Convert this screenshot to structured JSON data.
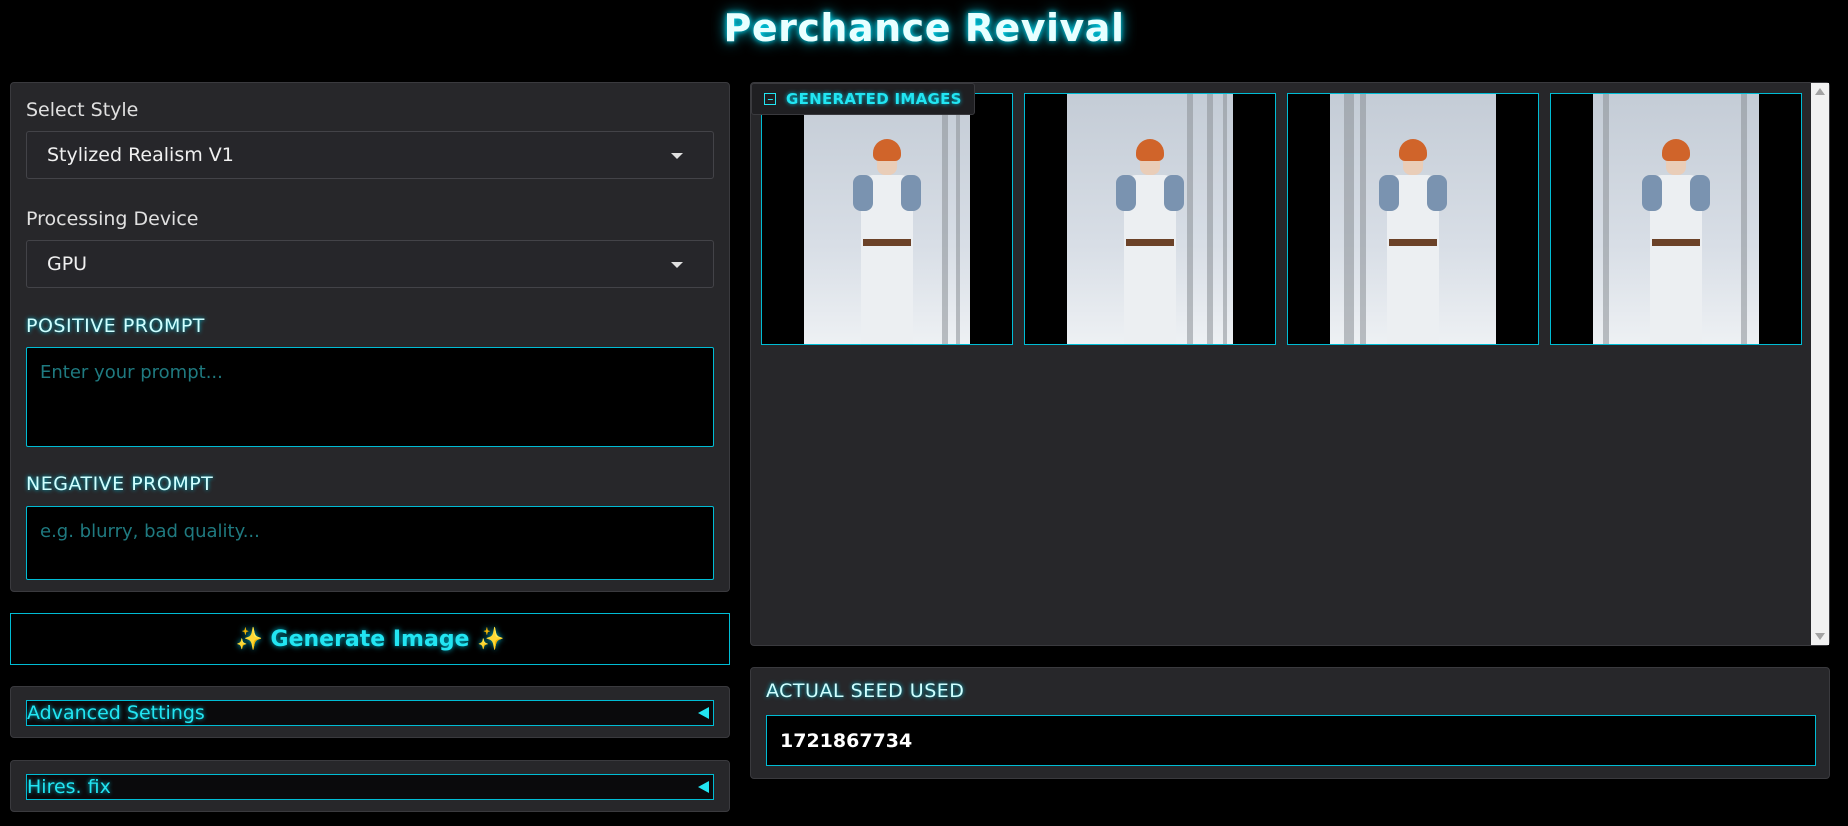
{
  "app": {
    "title": "Perchance Revival"
  },
  "style": {
    "label": "Select Style",
    "value": "Stylized Realism V1"
  },
  "device": {
    "label": "Processing Device",
    "value": "GPU"
  },
  "positive": {
    "label": "POSITIVE PROMPT",
    "placeholder": "Enter your prompt..."
  },
  "negative": {
    "label": "NEGATIVE PROMPT",
    "placeholder": "e.g. blurry, bad quality..."
  },
  "generate": {
    "label": "✨ Generate Image ✨"
  },
  "advanced": {
    "label": "Advanced Settings"
  },
  "hires": {
    "label": "Hires. fix"
  },
  "gallery": {
    "label": "GENERATED IMAGES",
    "image_count": 4
  },
  "seed": {
    "label": "ACTUAL SEED USED",
    "value": "1721867734"
  },
  "colors": {
    "accent": "#00bcd4",
    "accent_text": "#22e5f2",
    "panel": "#27272a",
    "background": "#000000"
  }
}
